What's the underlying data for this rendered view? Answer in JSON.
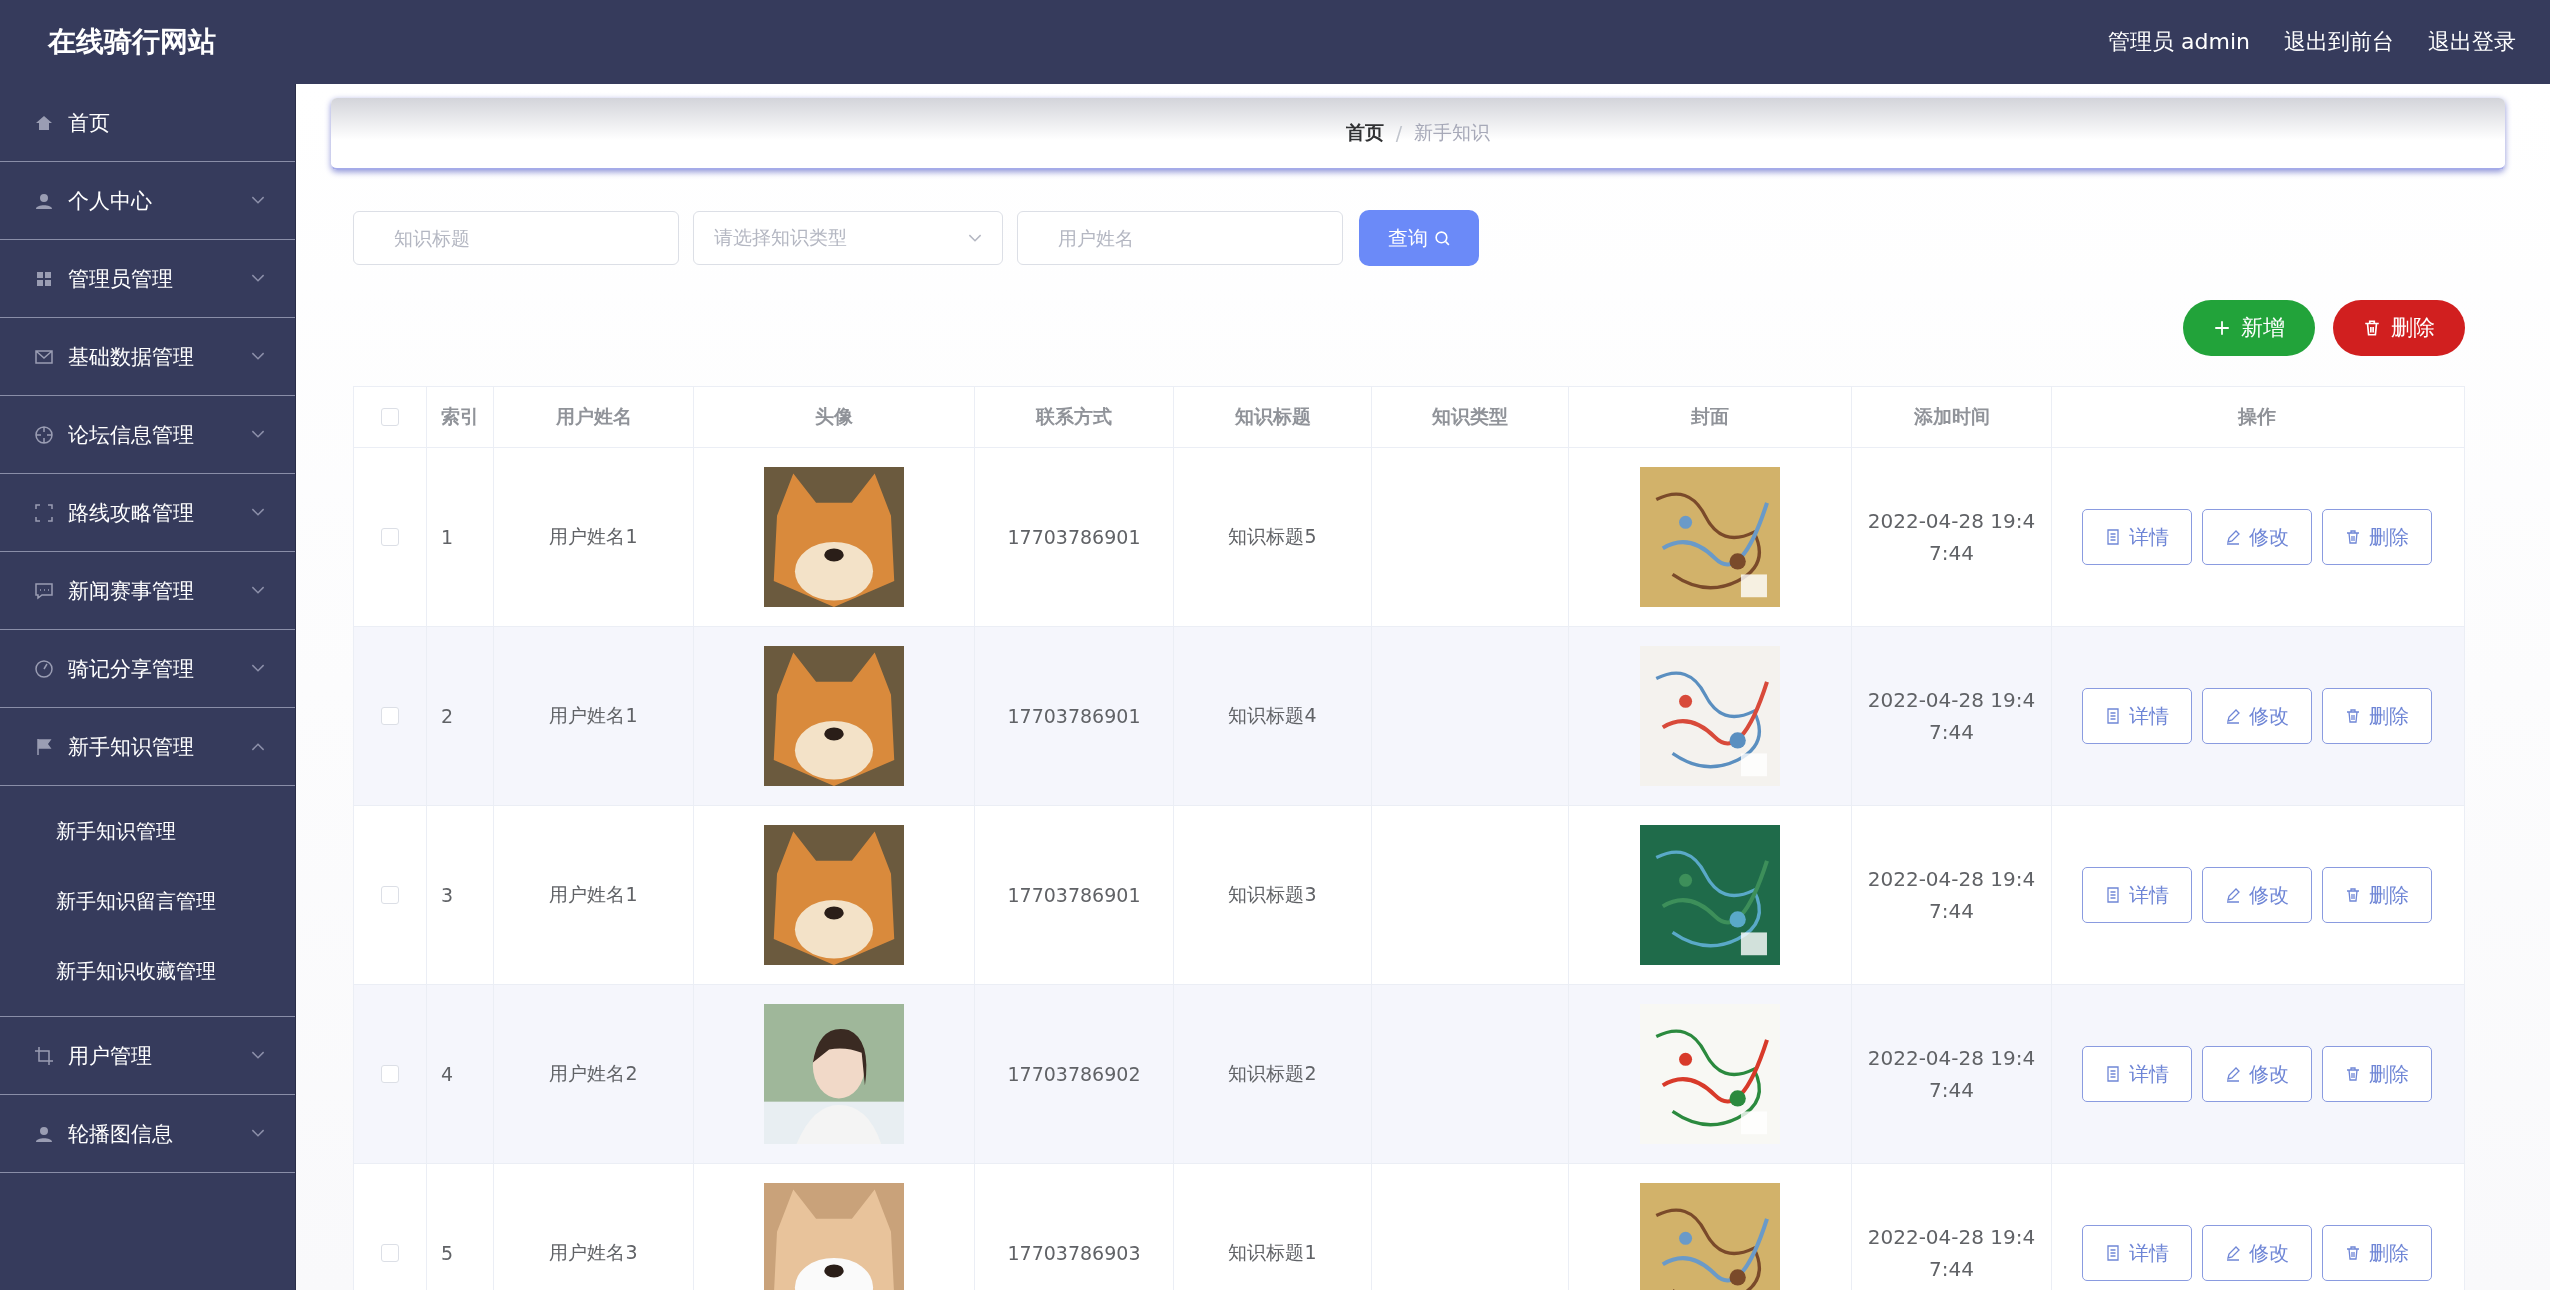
{
  "header": {
    "title": "在线骑行网站",
    "links": [
      "管理员 admin",
      "退出到前台",
      "退出登录"
    ]
  },
  "sidebar": {
    "items": [
      {
        "label": "首页",
        "kind": "link"
      },
      {
        "label": "个人中心",
        "kind": "menu",
        "expanded": false
      },
      {
        "label": "管理员管理",
        "kind": "menu",
        "expanded": false
      },
      {
        "label": "基础数据管理",
        "kind": "menu",
        "expanded": false
      },
      {
        "label": "论坛信息管理",
        "kind": "menu",
        "expanded": false
      },
      {
        "label": "路线攻略管理",
        "kind": "menu",
        "expanded": false
      },
      {
        "label": "新闻赛事管理",
        "kind": "menu",
        "expanded": false
      },
      {
        "label": "骑记分享管理",
        "kind": "menu",
        "expanded": false
      },
      {
        "label": "新手知识管理",
        "kind": "menu",
        "expanded": true,
        "children": [
          {
            "label": "新手知识管理"
          },
          {
            "label": "新手知识留言管理"
          },
          {
            "label": "新手知识收藏管理"
          }
        ]
      },
      {
        "label": "用户管理",
        "kind": "menu",
        "expanded": false
      },
      {
        "label": "轮播图信息",
        "kind": "menu",
        "expanded": false
      }
    ]
  },
  "breadcrumb": {
    "items": [
      "首页",
      "新手知识"
    ],
    "separator": "/"
  },
  "filters": {
    "title": {
      "placeholder": "知识标题"
    },
    "type": {
      "placeholder": "请选择知识类型"
    },
    "user": {
      "placeholder": "用户姓名"
    },
    "search_button": "查询"
  },
  "actions": {
    "add": "新增",
    "delete": "删除"
  },
  "table": {
    "select_all": {
      "checked": false
    },
    "columns": [
      "索引",
      "用户姓名",
      "头像",
      "联系方式",
      "知识标题",
      "知识类型",
      "封面",
      "添加时间",
      "操作"
    ],
    "rows": [
      {
        "checked": false,
        "index": "1",
        "name": "用户姓名1",
        "avatar": {
          "kind": "picture"
        },
        "phone": "17703786901",
        "title": "知识标题5",
        "cover": {
          "kind": "picture"
        },
        "time": "2022-04-28 19:47:44",
        "buttons": [
          "详情",
          "修改",
          "删除"
        ]
      },
      {
        "checked": false,
        "index": "2",
        "name": "用户姓名1",
        "avatar": {
          "kind": "picture"
        },
        "phone": "17703786901",
        "title": "知识标题4",
        "cover": {
          "kind": "picture"
        },
        "time": "2022-04-28 19:47:44",
        "buttons": [
          "详情",
          "修改",
          "删除"
        ]
      },
      {
        "checked": false,
        "index": "3",
        "name": "用户姓名1",
        "avatar": {
          "kind": "picture"
        },
        "phone": "17703786901",
        "title": "知识标题3",
        "cover": {
          "kind": "picture"
        },
        "time": "2022-04-28 19:47:44",
        "buttons": [
          "详情",
          "修改",
          "删除"
        ]
      },
      {
        "checked": false,
        "index": "4",
        "name": "用户姓名2",
        "avatar": {
          "kind": "picture"
        },
        "phone": "17703786902",
        "title": "知识标题2",
        "cover": {
          "kind": "picture"
        },
        "time": "2022-04-28 19:47:44",
        "buttons": [
          "详情",
          "修改",
          "删除"
        ]
      },
      {
        "checked": false,
        "index": "5",
        "name": "用户姓名3",
        "avatar": {
          "kind": "picture"
        },
        "phone": "17703786903",
        "title": "知识标题1",
        "cover": {
          "kind": "picture"
        },
        "time": "2022-04-28 19:47:44",
        "buttons": [
          "详情",
          "修改",
          "删除"
        ]
      }
    ]
  }
}
